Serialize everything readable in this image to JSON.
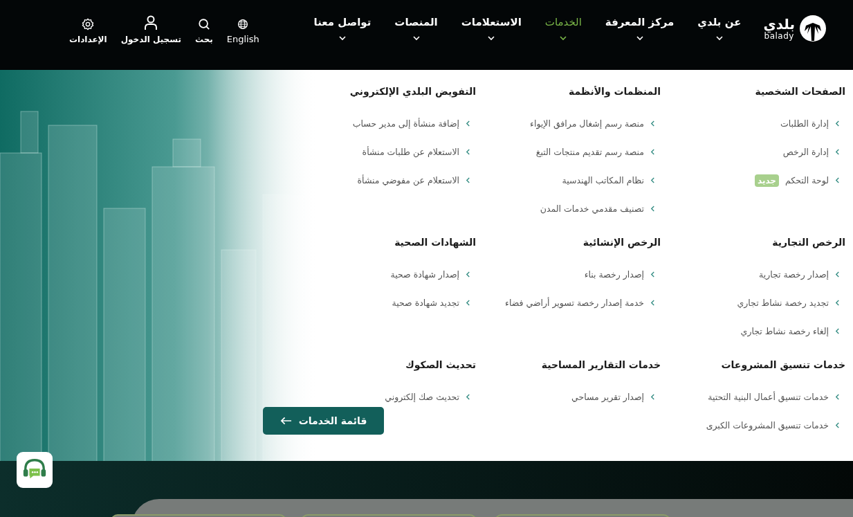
{
  "logo": {
    "text": "بلدي",
    "subtext": "balady"
  },
  "nav": [
    {
      "label": "عن بلدي",
      "selected": false
    },
    {
      "label": "مركز المعرفة",
      "selected": false
    },
    {
      "label": "الخدمات",
      "selected": true
    },
    {
      "label": "الاستعلامات",
      "selected": false
    },
    {
      "label": "المنصات",
      "selected": false
    },
    {
      "label": "تواصل معنا",
      "selected": false
    }
  ],
  "tools": [
    {
      "kind": "language",
      "label": "English"
    },
    {
      "kind": "search",
      "label": "بحث"
    },
    {
      "kind": "login",
      "label": "تسجيل الدخول"
    },
    {
      "kind": "settings",
      "label": "الإعدادات"
    }
  ],
  "menu": {
    "sections": [
      {
        "title": "الصفحات الشخصية",
        "items": [
          {
            "label": "إدارة الطلبات"
          },
          {
            "label": "إدارة الرخص"
          },
          {
            "label": "لوحة التحكم",
            "badge": "جديد"
          }
        ]
      },
      {
        "title": "المنظمات والأنظمة",
        "items": [
          {
            "label": "منصة رسم إشغال مرافق الإيواء"
          },
          {
            "label": "منصة رسم تقديم منتجات التبغ"
          },
          {
            "label": "نظام المكاتب الهندسية"
          },
          {
            "label": "تصنيف مقدمي خدمات المدن"
          }
        ]
      },
      {
        "title": "التفويض البلدي الإلكتروني",
        "items": [
          {
            "label": "إضافة منشأة إلى مدير حساب"
          },
          {
            "label": "الاستعلام عن طلبات منشأة"
          },
          {
            "label": "الاستعلام عن مفوضي منشأة"
          }
        ]
      },
      {
        "title": "الرخص التجارية",
        "items": [
          {
            "label": "إصدار رخصة تجارية"
          },
          {
            "label": "تجديد رخصة نشاط تجاري"
          },
          {
            "label": "إلغاء رخصة نشاط تجاري"
          }
        ]
      },
      {
        "title": "الرخص الإنشائية",
        "items": [
          {
            "label": "إصدار رخصة بناء"
          },
          {
            "label": "خدمة إصدار رخصة تسوير أراضي فضاء"
          }
        ]
      },
      {
        "title": "الشهادات الصحية",
        "items": [
          {
            "label": "إصدار شهادة صحية"
          },
          {
            "label": "تجديد شهادة صحية"
          }
        ]
      },
      {
        "title": "خدمات تنسيق المشروعات",
        "items": [
          {
            "label": "خدمات تنسيق أعمال البنية التحتية"
          },
          {
            "label": "خدمات تنسيق المشروعات الكبرى"
          }
        ]
      },
      {
        "title": "خدمات التقارير المساحية",
        "items": [
          {
            "label": "إصدار تقرير مساحي"
          }
        ]
      },
      {
        "title": "تحديث الصكوك",
        "items": [
          {
            "label": "تحديث صك إلكتروني"
          }
        ]
      }
    ],
    "all_services_button": "قائمة الخدمات"
  }
}
